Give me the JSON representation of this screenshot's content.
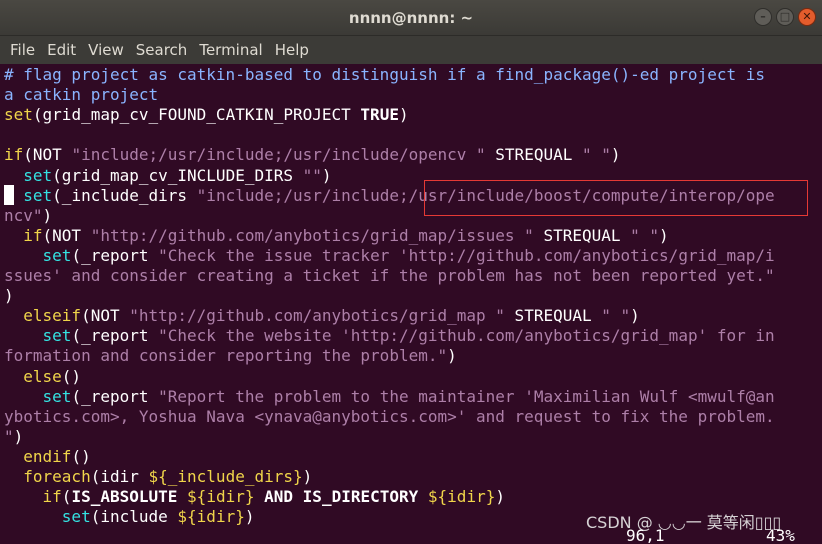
{
  "window": {
    "title": "nnnn@nnnn: ~",
    "minimize_glyph": "–",
    "maximize_glyph": "□",
    "close_glyph": "✕"
  },
  "menu": [
    "File",
    "Edit",
    "View",
    "Search",
    "Terminal",
    "Help"
  ],
  "colors": {
    "background": "#300a24",
    "comment": "#8ab4ff",
    "string": "#ad7fa8",
    "keyword": "#f0d54a",
    "command": "#34e2e2",
    "highlight_box": "#e53935"
  },
  "editor": {
    "lines": [
      [
        {
          "t": "# flag project as catkin-based to distinguish if a find_package()-ed project is",
          "c": "comment"
        }
      ],
      [
        {
          "t": "a catkin project",
          "c": "comment"
        }
      ],
      [
        {
          "t": "set",
          "c": "kw"
        },
        {
          "t": "(grid_map_cv_FOUND_CATKIN_PROJECT ",
          "c": "plain"
        },
        {
          "t": "TRUE",
          "c": "bold"
        },
        {
          "t": ")",
          "c": "plain"
        }
      ],
      [
        {
          "t": "",
          "c": "plain"
        }
      ],
      [
        {
          "t": "if",
          "c": "kw"
        },
        {
          "t": "(NOT ",
          "c": "plain"
        },
        {
          "t": "\"include;/usr/include;/usr/include/opencv \"",
          "c": "str"
        },
        {
          "t": " STREQUAL ",
          "c": "plain"
        },
        {
          "t": "\" \"",
          "c": "str"
        },
        {
          "t": ")",
          "c": "plain"
        }
      ],
      [
        {
          "t": "  set",
          "c": "cmd"
        },
        {
          "t": "(grid_map_cv_INCLUDE_DIRS ",
          "c": "plain"
        },
        {
          "t": "\"\"",
          "c": "str"
        },
        {
          "t": ")",
          "c": "plain"
        }
      ],
      [
        {
          "t": "  set",
          "c": "cmd"
        },
        {
          "t": "(_include_dirs ",
          "c": "plain"
        },
        {
          "t": "\"include;/usr/include;/usr/include/boost/compute/interop/ope",
          "c": "str"
        }
      ],
      [
        {
          "t": "ncv\"",
          "c": "str"
        },
        {
          "t": ")",
          "c": "plain"
        }
      ],
      [
        {
          "t": "  if",
          "c": "kw"
        },
        {
          "t": "(NOT ",
          "c": "plain"
        },
        {
          "t": "\"http://github.com/anybotics/grid_map/issues \"",
          "c": "str"
        },
        {
          "t": " STREQUAL ",
          "c": "plain"
        },
        {
          "t": "\" \"",
          "c": "str"
        },
        {
          "t": ")",
          "c": "plain"
        }
      ],
      [
        {
          "t": "    set",
          "c": "cmd"
        },
        {
          "t": "(_report ",
          "c": "plain"
        },
        {
          "t": "\"Check the issue tracker 'http://github.com/anybotics/grid_map/i",
          "c": "str"
        }
      ],
      [
        {
          "t": "ssues' and consider creating a ticket if the problem has not been reported yet.\"",
          "c": "str"
        }
      ],
      [
        {
          "t": ")",
          "c": "plain"
        }
      ],
      [
        {
          "t": "  elseif",
          "c": "kw"
        },
        {
          "t": "(NOT ",
          "c": "plain"
        },
        {
          "t": "\"http://github.com/anybotics/grid_map \"",
          "c": "str"
        },
        {
          "t": " STREQUAL ",
          "c": "plain"
        },
        {
          "t": "\" \"",
          "c": "str"
        },
        {
          "t": ")",
          "c": "plain"
        }
      ],
      [
        {
          "t": "    set",
          "c": "cmd"
        },
        {
          "t": "(_report ",
          "c": "plain"
        },
        {
          "t": "\"Check the website 'http://github.com/anybotics/grid_map' for in",
          "c": "str"
        }
      ],
      [
        {
          "t": "formation and consider reporting the problem.\"",
          "c": "str"
        },
        {
          "t": ")",
          "c": "plain"
        }
      ],
      [
        {
          "t": "  else",
          "c": "kw"
        },
        {
          "t": "()",
          "c": "plain"
        }
      ],
      [
        {
          "t": "    set",
          "c": "cmd"
        },
        {
          "t": "(_report ",
          "c": "plain"
        },
        {
          "t": "\"Report the problem to the maintainer 'Maximilian Wulf <mwulf@an",
          "c": "str"
        }
      ],
      [
        {
          "t": "ybotics.com>, Yoshua Nava <ynava@anybotics.com>' and request to fix the problem.",
          "c": "str"
        }
      ],
      [
        {
          "t": "\"",
          "c": "str"
        },
        {
          "t": ")",
          "c": "plain"
        }
      ],
      [
        {
          "t": "  endif",
          "c": "kw"
        },
        {
          "t": "()",
          "c": "plain"
        }
      ],
      [
        {
          "t": "  foreach",
          "c": "kw"
        },
        {
          "t": "(idir ",
          "c": "plain"
        },
        {
          "t": "${_include_dirs}",
          "c": "kw"
        },
        {
          "t": ")",
          "c": "plain"
        }
      ],
      [
        {
          "t": "    if",
          "c": "kw"
        },
        {
          "t": "(",
          "c": "plain"
        },
        {
          "t": "IS_ABSOLUTE",
          "c": "bold"
        },
        {
          "t": " ",
          "c": "plain"
        },
        {
          "t": "${idir}",
          "c": "kw"
        },
        {
          "t": " ",
          "c": "plain"
        },
        {
          "t": "AND",
          "c": "bold"
        },
        {
          "t": " ",
          "c": "plain"
        },
        {
          "t": "IS_DIRECTORY",
          "c": "bold"
        },
        {
          "t": " ",
          "c": "plain"
        },
        {
          "t": "${idir}",
          "c": "kw"
        },
        {
          "t": ")",
          "c": "plain"
        }
      ],
      [
        {
          "t": "      set",
          "c": "cmd"
        },
        {
          "t": "(include ",
          "c": "plain"
        },
        {
          "t": "${idir}",
          "c": "kw"
        },
        {
          "t": ")",
          "c": "plain"
        }
      ]
    ]
  },
  "status": {
    "position": "96,1",
    "percent": "43%"
  },
  "watermark": "CSDN @ ◡◡一 莫等闲▯▯▯"
}
